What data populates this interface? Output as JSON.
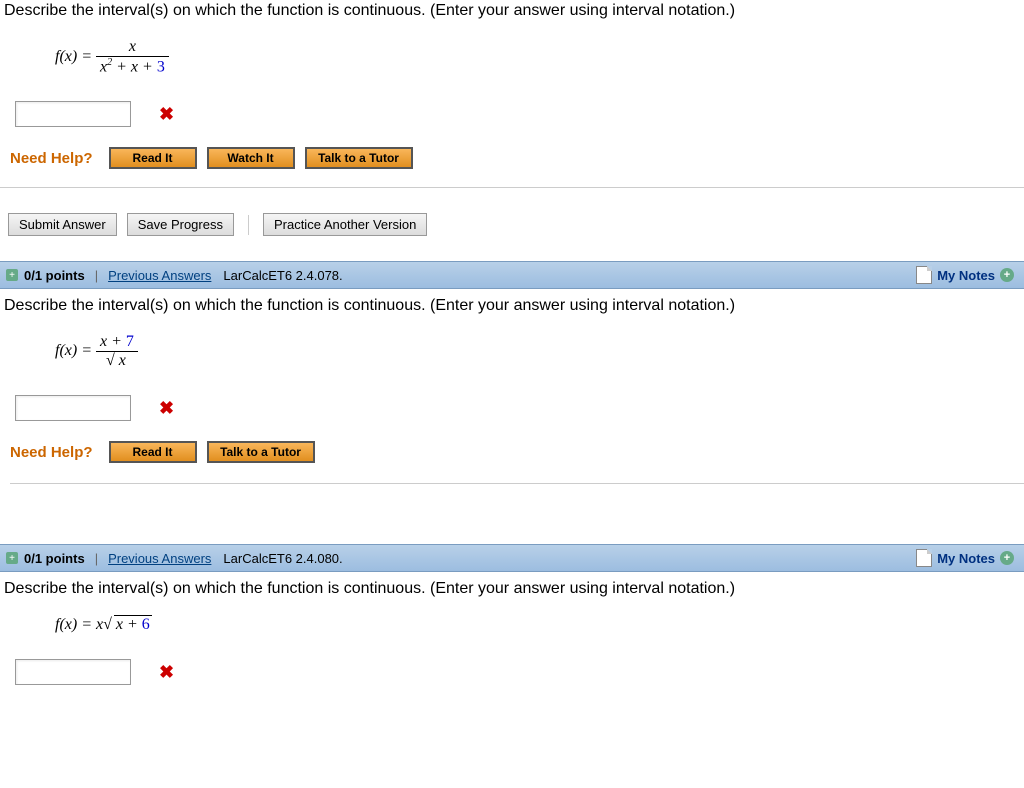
{
  "q1": {
    "prompt": "Describe the interval(s) on which the function is continuous. (Enter your answer using interval notation.)",
    "formula_lhs": "f(x) =",
    "numerator": "x",
    "denom_a": "x",
    "denom_exp": "2",
    "denom_rest": " + x + ",
    "denom_const": "3",
    "help_label": "Need Help?",
    "read": "Read It",
    "watch": "Watch It",
    "tutor": "Talk to a Tutor",
    "submit": "Submit Answer",
    "save": "Save Progress",
    "practice": "Practice Another Version"
  },
  "hdr2": {
    "points": "0/1 points",
    "prev": "Previous Answers",
    "ref": "LarCalcET6 2.4.078.",
    "mynotes": "My Notes"
  },
  "q2": {
    "prompt": "Describe the interval(s) on which the function is continuous. (Enter your answer using interval notation.)",
    "formula_lhs": "f(x) =",
    "num_a": "x + ",
    "num_const": "7",
    "den_var": "x",
    "help_label": "Need Help?",
    "read": "Read It",
    "tutor": "Talk to a Tutor"
  },
  "hdr3": {
    "points": "0/1 points",
    "prev": "Previous Answers",
    "ref": "LarCalcET6 2.4.080.",
    "mynotes": "My Notes"
  },
  "q3": {
    "prompt": "Describe the interval(s) on which the function is continuous. (Enter your answer using interval notation.)",
    "formula_lhs": "f(x) = x",
    "rad_a": "x + ",
    "rad_const": "6"
  }
}
